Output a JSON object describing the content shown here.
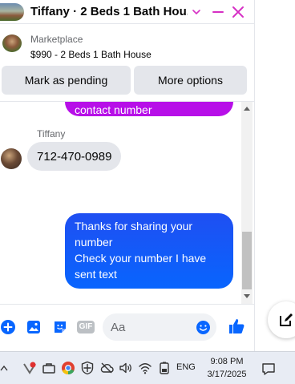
{
  "header": {
    "title": "Tiffany · 2 Beds 1 Bath Hou...",
    "icons": [
      "chevron-down-icon",
      "minimize-icon",
      "close-icon"
    ]
  },
  "marketplace": {
    "label": "Marketplace",
    "title": "$990 - 2 Beds 1 Bath House"
  },
  "actions": {
    "pending_label": "Mark as pending",
    "more_label": "More options"
  },
  "messages": {
    "previous_partial": "contact number",
    "sender_name": "Tiffany",
    "incoming": "712-470-0989",
    "outgoing_lines": [
      "Thanks for sharing your",
      "number",
      "Check your number I have",
      "sent text"
    ]
  },
  "composer": {
    "placeholder": "Aa",
    "icons": [
      "plus-icon",
      "image-icon",
      "sticker-icon",
      "gif-icon",
      "emoji-icon",
      "like-icon"
    ],
    "gif_label": "GIF"
  },
  "taskbar": {
    "language": "ENG",
    "time": "9:08 PM",
    "date": "3/17/2025"
  },
  "colors": {
    "messenger_blue": "#0866ff",
    "outgoing_bubble": "#1f4ff2",
    "purple_bubble": "#b70fe8",
    "incoming_bubble": "#e4e6eb",
    "header_accent": "#d62fc4"
  }
}
